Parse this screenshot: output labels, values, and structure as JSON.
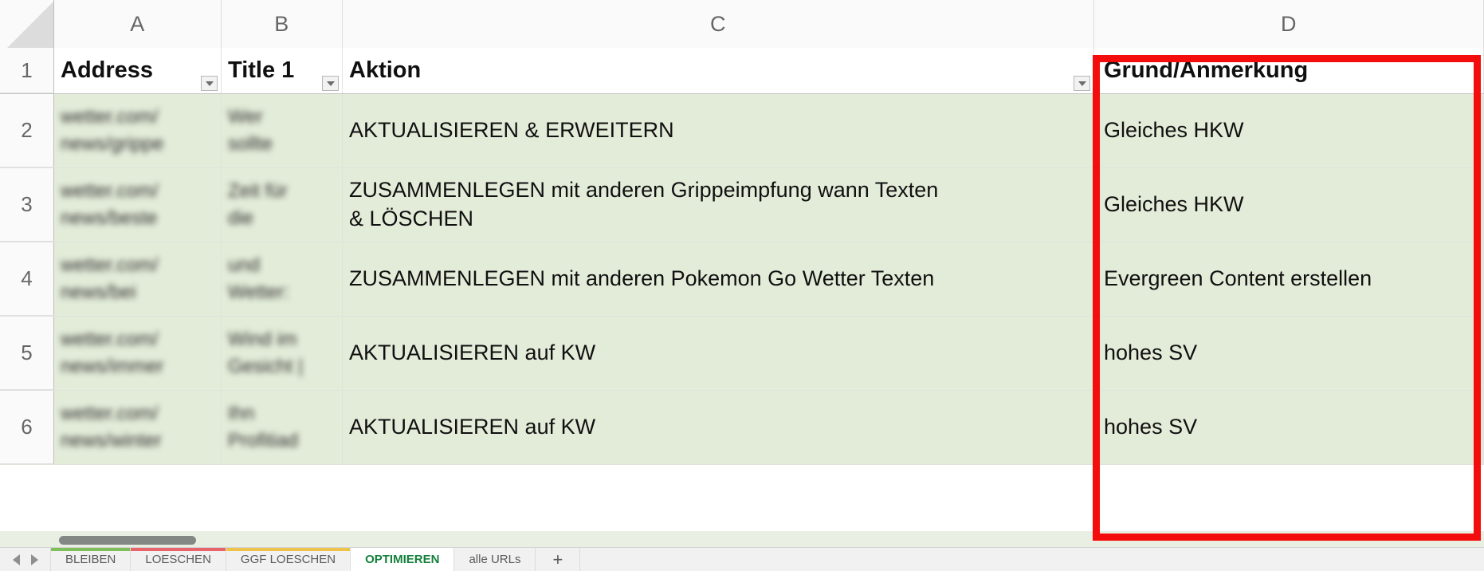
{
  "spreadsheet": {
    "column_headers": [
      "A",
      "B",
      "C",
      "D"
    ],
    "row_numbers": [
      "1",
      "2",
      "3",
      "4",
      "5",
      "6"
    ],
    "header_row": {
      "A": "Address",
      "B": "Title 1",
      "C": "Aktion",
      "D": "Grund/Anmerkung"
    },
    "rows": [
      {
        "num": "2",
        "A": "wetter.com/\nnews/grippe",
        "B": "Wer\nsollte",
        "C": "AKTUALISIEREN & ERWEITERN",
        "D": "Gleiches HKW"
      },
      {
        "num": "3",
        "A": "wetter.com/\nnews/beste",
        "B": "Zeit für\ndie",
        "C": "ZUSAMMENLEGEN mit anderen Grippeimpfung wann Texten\n& LÖSCHEN",
        "D": "Gleiches HKW"
      },
      {
        "num": "4",
        "A": "wetter.com/\nnews/bei",
        "B": "und\nWetter:",
        "C": "ZUSAMMENLEGEN mit anderen Pokemon Go Wetter Texten",
        "D": "Evergreen Content erstellen"
      },
      {
        "num": "5",
        "A": "wetter.com/\nnews/immer",
        "B": "Wind im\nGesicht |",
        "C": "AKTUALISIEREN auf KW",
        "D": "hohes SV"
      },
      {
        "num": "6",
        "A": "wetter.com/\nnews/winter",
        "B": "Ihn\nProfitiad",
        "C": "AKTUALISIEREN auf KW",
        "D": "hohes SV"
      }
    ]
  },
  "annotation": {
    "highlight_color": "#f40d0d",
    "highlighted_column": "D"
  },
  "icons": {
    "filter_dropdown": "filter-dropdown-icon",
    "select_all_corner": "select-all-corner-icon",
    "nav_prev": "nav-prev-icon",
    "nav_next": "nav-next-icon",
    "add_sheet": "+"
  },
  "sheet_tabs": [
    {
      "label": "BLEIBEN",
      "accent": "#7fbf5a",
      "active": false
    },
    {
      "label": "LOESCHEN",
      "accent": "#e8646a",
      "active": false
    },
    {
      "label": "GGF LOESCHEN",
      "accent": "#eec34a",
      "active": false
    },
    {
      "label": "OPTIMIEREN",
      "accent": "#ffffff",
      "active": true
    },
    {
      "label": "alle URLs",
      "accent": "#f1f1f1",
      "active": false
    }
  ],
  "colors": {
    "cell_green": "#e3ecd9",
    "header_white": "#ffffff",
    "active_tab_text": "#14803c",
    "grid_line": "#dfe3dc"
  }
}
